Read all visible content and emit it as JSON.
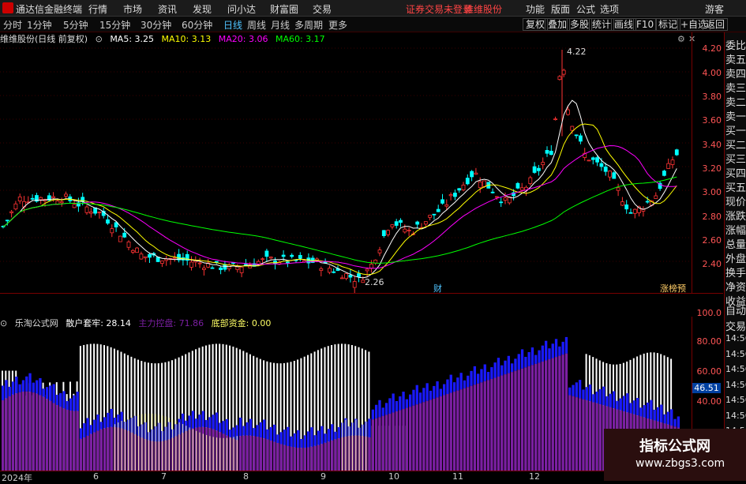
{
  "titlebar": {
    "app_name": "通达信金融终端",
    "menus": [
      "行情",
      "市场",
      "资讯",
      "发现",
      "问小达",
      "财富圈",
      "交易"
    ],
    "notice": "证券交易未登录",
    "stock": "维维股份",
    "right_menus": [
      "功能",
      "版面",
      "公式",
      "选项"
    ],
    "user": "游客"
  },
  "toolbar": {
    "tabs": [
      "分时",
      "1分钟",
      "5分钟",
      "15分钟",
      "30分钟",
      "60分钟",
      "日线",
      "周线",
      "月线",
      "多周期",
      "更多"
    ],
    "active_tab": "日线",
    "right_buttons": [
      "复权",
      "叠加",
      "多股",
      "统计",
      "画线",
      "F10",
      "标记",
      "+自选",
      "返回"
    ]
  },
  "main_chart": {
    "title": "维维股份(日线 前复权)",
    "ma": [
      {
        "label": "MA5: 3.25",
        "color": "#ffffff"
      },
      {
        "label": "MA10: 3.13",
        "color": "#ffff00"
      },
      {
        "label": "MA20: 3.06",
        "color": "#ff00ff"
      },
      {
        "label": "MA60: 3.17",
        "color": "#00ff00"
      }
    ],
    "high_label": "4.22",
    "low_label": "2.26",
    "marker_cai": "财",
    "marker_zt": "涨榜预",
    "y_ticks": [
      "4.20",
      "4.00",
      "3.80",
      "3.60",
      "3.40",
      "3.20",
      "3.00",
      "2.80",
      "2.60",
      "2.40"
    ]
  },
  "indicator": {
    "source": "乐淘公式网",
    "retail_label": "散户套牢: 28.14",
    "main_label": "主力控盘: 71.86",
    "bottom_label": "底部资金: 0.00",
    "y_ticks": [
      "100.0",
      "80.00",
      "60.00",
      "40.00"
    ],
    "current_tag": "46.51"
  },
  "time_axis": [
    "2024年",
    "6",
    "7",
    "8",
    "9",
    "10",
    "11",
    "12"
  ],
  "right_column": {
    "top_items": [
      "委比",
      "卖五",
      "卖四",
      "卖三",
      "卖二",
      "卖一",
      "买一",
      "买二",
      "买三",
      "买四",
      "买五",
      "现价",
      "涨跌",
      "涨幅",
      "总量",
      "外盘",
      "换手",
      "净资",
      "收益"
    ],
    "bottom_items": [
      "自动",
      "交易",
      "14:56",
      "14:56",
      "14:56",
      "14:56",
      "14:56",
      "14:56",
      "14:56",
      "14:56"
    ]
  },
  "watermark": {
    "line1": "指标公式网",
    "line2": "www.zbgs3.com"
  },
  "colors": {
    "up": "#ff3333",
    "down": "#00ffff",
    "ma5": "#ffffff",
    "ma10": "#ffff00",
    "ma20": "#ff00ff",
    "ma60": "#00ff00",
    "retail": "#ffffff",
    "main_force": "#7b1fa2",
    "blue": "#1a1aff",
    "bottom_fund": "#ffff99"
  }
}
